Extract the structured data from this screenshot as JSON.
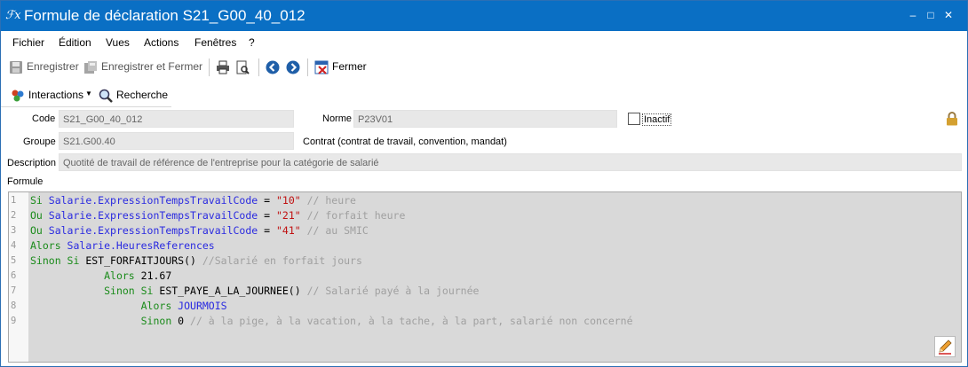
{
  "window": {
    "title": "Formule de déclaration S21_G00_40_012",
    "app_icon_text": "ℱx",
    "controls": [
      "–",
      "□",
      "✕"
    ]
  },
  "menu": [
    "Fichier",
    "Édition",
    "Vues",
    "Actions",
    "Fenêtres",
    "?"
  ],
  "toolbar": {
    "save": "Enregistrer",
    "save_close": "Enregistrer et Fermer",
    "close": "Fermer"
  },
  "toolbar2": {
    "interactions": "Interactions",
    "search": "Recherche"
  },
  "form": {
    "code_label": "Code",
    "code_value": "S21_G00_40_012",
    "norme_label": "Norme",
    "norme_value": "P23V01",
    "inactif_label": "Inactif",
    "inactif_checked": false,
    "groupe_label": "Groupe",
    "groupe_value": "S21.G00.40",
    "groupe_desc": "Contrat (contrat de travail, convention, mandat)",
    "description_label": "Description",
    "description_value": "Quotité de travail de référence de l'entreprise pour la catégorie de salarié",
    "formule_label": "Formule"
  },
  "code_lines": [
    {
      "n": "1",
      "tokens": [
        [
          "kw",
          "Si "
        ],
        [
          "id",
          "Salarie.ExpressionTempsTravailCode"
        ],
        [
          "pl",
          " = "
        ],
        [
          "str",
          "\"10\""
        ],
        [
          "cm",
          " // heure"
        ]
      ]
    },
    {
      "n": "2",
      "tokens": [
        [
          "kw",
          "Ou "
        ],
        [
          "id",
          "Salarie.ExpressionTempsTravailCode"
        ],
        [
          "pl",
          " = "
        ],
        [
          "str",
          "\"21\""
        ],
        [
          "cm",
          " // forfait heure"
        ]
      ]
    },
    {
      "n": "3",
      "tokens": [
        [
          "kw",
          "Ou "
        ],
        [
          "id",
          "Salarie.ExpressionTempsTravailCode"
        ],
        [
          "pl",
          " = "
        ],
        [
          "str",
          "\"41\""
        ],
        [
          "cm",
          " // au SMIC"
        ]
      ]
    },
    {
      "n": "4",
      "tokens": [
        [
          "kw",
          "Alors "
        ],
        [
          "id",
          "Salarie.HeuresReferences"
        ]
      ]
    },
    {
      "n": "5",
      "tokens": [
        [
          "kw",
          "Sinon Si "
        ],
        [
          "pl",
          "EST_FORFAITJOURS() "
        ],
        [
          "cm",
          "//Salarié en forfait jours"
        ]
      ]
    },
    {
      "n": "6",
      "tokens": [
        [
          "pl",
          "            "
        ],
        [
          "kw",
          "Alors "
        ],
        [
          "pl",
          "21.67"
        ]
      ]
    },
    {
      "n": "7",
      "tokens": [
        [
          "pl",
          "            "
        ],
        [
          "kw",
          "Sinon Si "
        ],
        [
          "pl",
          "EST_PAYE_A_LA_JOURNEE() "
        ],
        [
          "cm",
          "// Salarié payé à la journée"
        ]
      ]
    },
    {
      "n": "8",
      "tokens": [
        [
          "pl",
          "                  "
        ],
        [
          "kw",
          "Alors "
        ],
        [
          "id",
          "JOURMOIS"
        ]
      ]
    },
    {
      "n": "9",
      "tokens": [
        [
          "pl",
          "                  "
        ],
        [
          "kw",
          "Sinon "
        ],
        [
          "pl",
          "0 "
        ],
        [
          "cm",
          "// à la pige, à la vacation, à la tache, à la part, salarié non concerné"
        ]
      ]
    }
  ],
  "colors": {
    "titlebar": "#0a6fc4",
    "keyword": "#1a8b1a",
    "identifier": "#2a2ae0",
    "string": "#c01010",
    "comment": "#a0a0a0"
  }
}
